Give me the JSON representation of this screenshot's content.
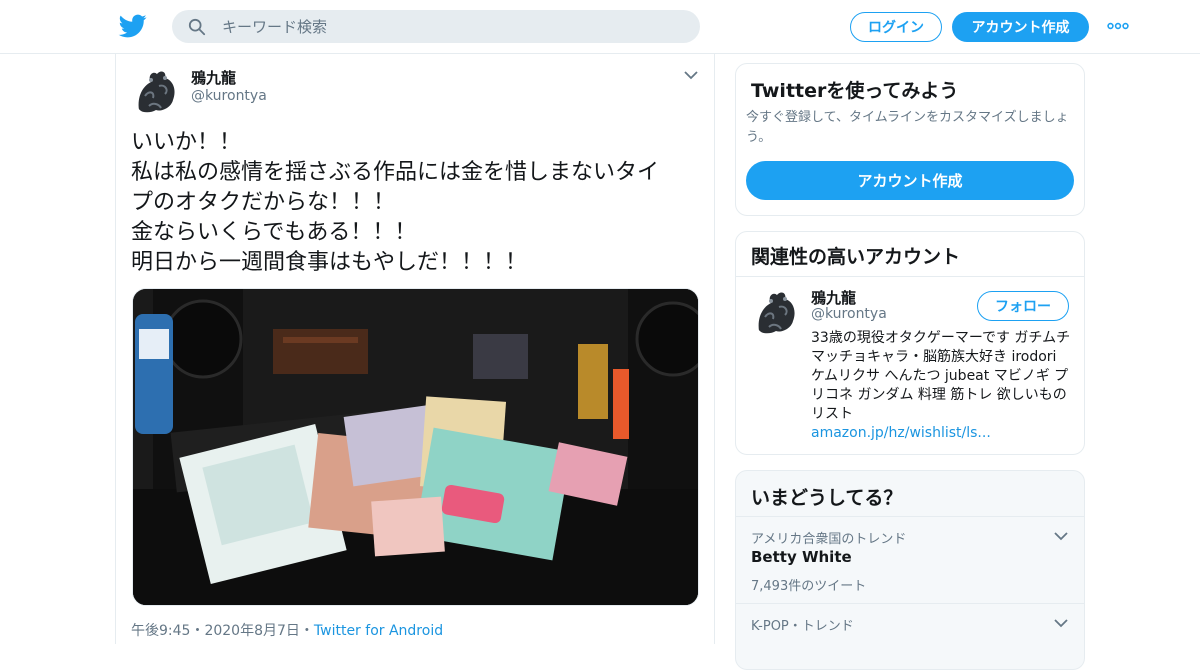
{
  "header": {
    "search_placeholder": "キーワード検索",
    "login_label": "ログイン",
    "signup_label": "アカウント作成",
    "brand_color": "#1da1f2"
  },
  "tweet": {
    "author_name": "鴉九龍",
    "author_handle": "@kurontya",
    "text_lines": [
      "いいか！！",
      "私は私の感情を揺さぶる作品には金を惜しまないタイ",
      "プのオタクだからな！！！",
      "金ならいくらでもある！！！",
      "明日から一週間食事はもやしだ！！！！"
    ],
    "timestamp": "午後9:45・2020年8月7日・",
    "source": "Twitter for Android"
  },
  "sidebar": {
    "try_card": {
      "title": "Twitterを使ってみよう",
      "subtitle": "今すぐ登録して、タイムラインをカスタマイズしましょう。",
      "button_label": "アカウント作成"
    },
    "related_card": {
      "title": "関連性の高いアカウント",
      "account_name": "鴉九龍",
      "account_handle": "@kurontya",
      "follow_label": "フォロー",
      "bio": "33歳の現役オタクゲーマーです ガチムチマッチョキャラ・脳筋族大好き irodori ケムリクサ へんたつ jubeat マビノギ プリコネ ガンダム 料理 筋トレ 欲しいものリスト",
      "bio_link": "amazon.jp/hz/wishlist/ls..."
    },
    "trends_card": {
      "title": "いまどうしてる？",
      "items": [
        {
          "context": "アメリカ合衆国のトレンド",
          "name": "Betty White",
          "count": "7,493件のツイート"
        },
        {
          "context": "K-POP・トレンド",
          "name": "",
          "count": ""
        }
      ]
    }
  }
}
